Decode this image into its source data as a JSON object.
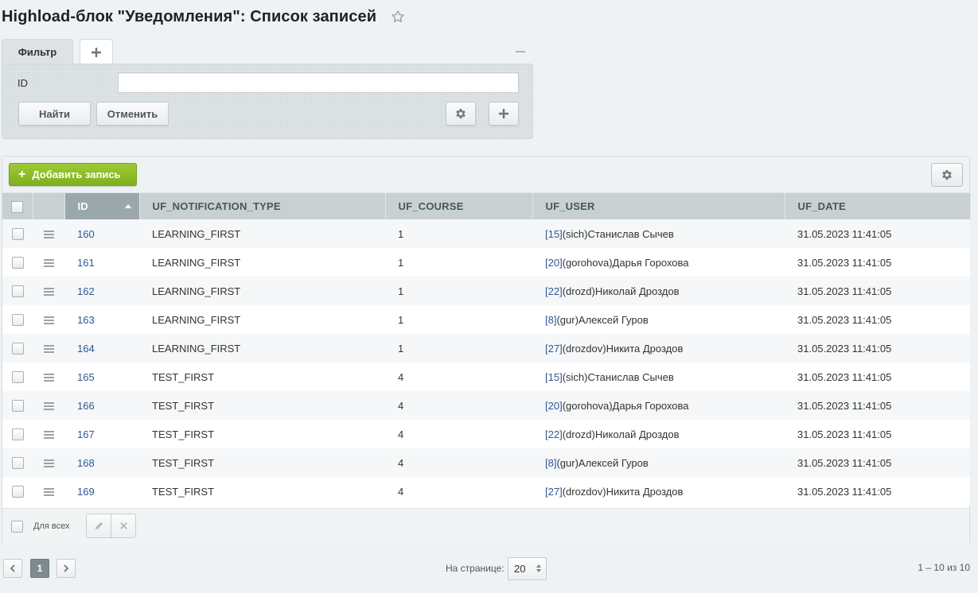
{
  "page": {
    "title": "Highload-блок \"Уведомления\": Список записей"
  },
  "filter": {
    "tab_label": "Фильтр",
    "field_label": "ID",
    "field_value": "",
    "find_label": "Найти",
    "cancel_label": "Отменить"
  },
  "grid": {
    "add_label": "Добавить запись",
    "columns": [
      "ID",
      "UF_NOTIFICATION_TYPE",
      "UF_COURSE",
      "UF_USER",
      "UF_DATE"
    ],
    "sort": {
      "column": "ID",
      "direction": "asc"
    },
    "rows": [
      {
        "id": "160",
        "type": "LEARNING_FIRST",
        "course": "1",
        "user_id": "[15]",
        "user_name": "(sich)Станислав Сычев",
        "date": "31.05.2023 11:41:05"
      },
      {
        "id": "161",
        "type": "LEARNING_FIRST",
        "course": "1",
        "user_id": "[20]",
        "user_name": "(gorohova)Дарья Горохова",
        "date": "31.05.2023 11:41:05"
      },
      {
        "id": "162",
        "type": "LEARNING_FIRST",
        "course": "1",
        "user_id": "[22]",
        "user_name": "(drozd)Николай Дроздов",
        "date": "31.05.2023 11:41:05"
      },
      {
        "id": "163",
        "type": "LEARNING_FIRST",
        "course": "1",
        "user_id": "[8]",
        "user_name": "(gur)Алексей Гуров",
        "date": "31.05.2023 11:41:05"
      },
      {
        "id": "164",
        "type": "LEARNING_FIRST",
        "course": "1",
        "user_id": "[27]",
        "user_name": "(drozdov)Никита Дроздов",
        "date": "31.05.2023 11:41:05"
      },
      {
        "id": "165",
        "type": "TEST_FIRST",
        "course": "4",
        "user_id": "[15]",
        "user_name": "(sich)Станислав Сычев",
        "date": "31.05.2023 11:41:05"
      },
      {
        "id": "166",
        "type": "TEST_FIRST",
        "course": "4",
        "user_id": "[20]",
        "user_name": "(gorohova)Дарья Горохова",
        "date": "31.05.2023 11:41:05"
      },
      {
        "id": "167",
        "type": "TEST_FIRST",
        "course": "4",
        "user_id": "[22]",
        "user_name": "(drozd)Николай Дроздов",
        "date": "31.05.2023 11:41:05"
      },
      {
        "id": "168",
        "type": "TEST_FIRST",
        "course": "4",
        "user_id": "[8]",
        "user_name": "(gur)Алексей Гуров",
        "date": "31.05.2023 11:41:05"
      },
      {
        "id": "169",
        "type": "TEST_FIRST",
        "course": "4",
        "user_id": "[27]",
        "user_name": "(drozdov)Никита Дроздов",
        "date": "31.05.2023 11:41:05"
      }
    ],
    "footer": {
      "for_all_label": "Для всех"
    }
  },
  "pagination": {
    "current_page": "1",
    "per_page_label": "На странице:",
    "per_page_value": "20",
    "range_text": "1 – 10 из 10"
  },
  "colors": {
    "accent_green": "#8cbf26",
    "link_blue": "#2d5896",
    "header_gray": "#c8d0d3",
    "sorted_header": "#9aa7ab"
  },
  "icons": [
    "star-icon",
    "plus-icon",
    "minus-icon",
    "gear-icon",
    "drag-handle-icon",
    "pencil-icon",
    "close-icon",
    "chevron-left-icon",
    "chevron-right-icon"
  ]
}
